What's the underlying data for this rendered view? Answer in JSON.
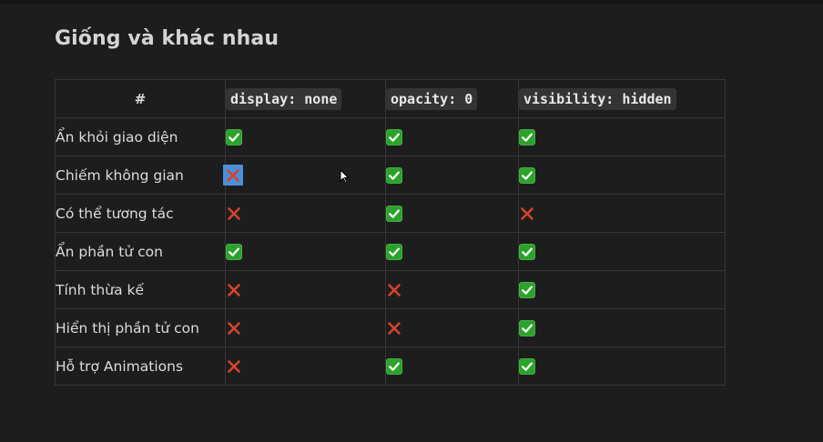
{
  "title": "Giống và khác nhau",
  "table": {
    "headers": [
      "#",
      "display: none",
      "opacity: 0",
      "visibility: hidden"
    ],
    "rows": [
      {
        "feature": "Ẩn khỏi giao diện",
        "values": [
          "check",
          "check",
          "check"
        ]
      },
      {
        "feature": "Chiếm không gian",
        "values": [
          "cross",
          "check",
          "check"
        ]
      },
      {
        "feature": "Có thể tương tác",
        "values": [
          "cross",
          "check",
          "cross"
        ]
      },
      {
        "feature": "Ẩn phần tử con",
        "values": [
          "check",
          "check",
          "check"
        ]
      },
      {
        "feature": "Tính thừa kế",
        "values": [
          "cross",
          "cross",
          "check"
        ]
      },
      {
        "feature": "Hiển thị phần tử con",
        "values": [
          "cross",
          "cross",
          "check"
        ]
      },
      {
        "feature": "Hỗ trợ Animations",
        "values": [
          "cross",
          "check",
          "check"
        ]
      }
    ]
  },
  "icons": {
    "check": "check-mark-button-icon",
    "cross": "cross-mark-icon",
    "cursor": "mouse-pointer-icon"
  },
  "colors": {
    "background": "#1d1d1d",
    "check_green": "#2aa32a",
    "cross_red": "#d6432b",
    "selection_blue": "#4a90d9"
  },
  "selection": {
    "row": 1,
    "col": 0
  }
}
